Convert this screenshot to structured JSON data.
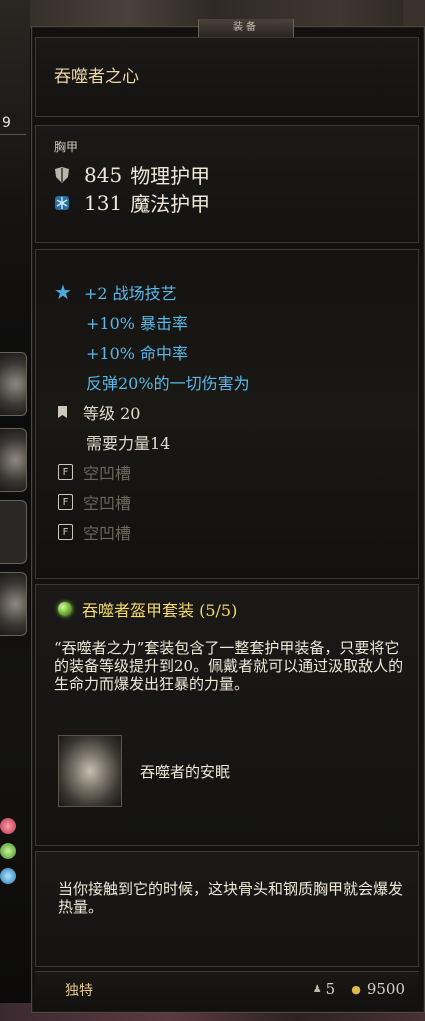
{
  "window": {
    "tab_title": "装备"
  },
  "background": {
    "stack_count": "9"
  },
  "item": {
    "name": "吞噬者之心",
    "slot": "胸甲",
    "physical_armor": {
      "value": "845",
      "label": "物理护甲"
    },
    "magic_armor": {
      "value": "131",
      "label": "魔法护甲"
    },
    "bonuses": [
      "+2 战场技艺",
      "+10% 暴击率",
      "+10% 命中率",
      "反弹20%的一切伤害为"
    ],
    "level": "等级 20",
    "requirement": "需要力量14",
    "sockets": [
      "空凹槽",
      "空凹槽",
      "空凹槽"
    ],
    "set": {
      "name": "吞噬者盔甲套装 (5/5)",
      "description": "“吞噬者之力”套装包含了一整套护甲装备，只要将它的装备等级提升到20。佩戴者就可以通过汲取敌人的生命力而爆发出狂暴的力量。",
      "item_name": "吞噬者的安眠"
    },
    "flavor_text": "当你接触到它的时候，这块骨头和钢质胸甲就会爆发热量。",
    "rarity": "独特",
    "weight": "5",
    "price": "9500"
  },
  "colors": {
    "stat_blue": "#59b8e8",
    "title_gold": "#ecd7a8",
    "set_yellow": "#f1d96b"
  }
}
